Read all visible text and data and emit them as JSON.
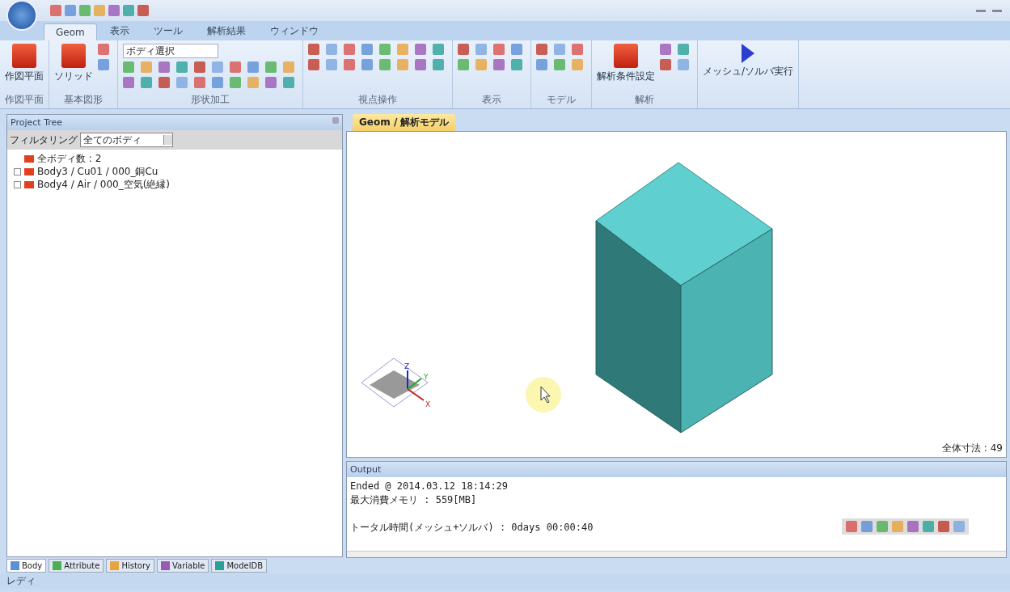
{
  "ribbon_tabs": [
    {
      "label": "Geom",
      "selected": true
    },
    {
      "label": "表示",
      "selected": false
    },
    {
      "label": "ツール",
      "selected": false
    },
    {
      "label": "解析結果",
      "selected": false
    },
    {
      "label": "ウィンドウ",
      "selected": false
    }
  ],
  "ribbon_groups": [
    {
      "label": "作図平面",
      "buttons": [
        "作図平面"
      ]
    },
    {
      "label": "基本図形",
      "buttons": [
        "ソリッド"
      ]
    },
    {
      "label": "形状加工",
      "combo": "ボディ選択"
    },
    {
      "label": "視点操作"
    },
    {
      "label": "表示"
    },
    {
      "label": "モデル"
    },
    {
      "label": "解析",
      "buttons": [
        "解析条件設定"
      ]
    },
    {
      "buttons": [
        "メッシュ/ソルバ実行"
      ]
    }
  ],
  "project_tree": {
    "title": "Project Tree",
    "filter_label": "フィルタリング",
    "filter_value": "全てのボディ",
    "items": [
      {
        "label": "全ボディ数 : 2",
        "expandable": false
      },
      {
        "label": "Body3 / Cu01 / 000_銅Cu",
        "expandable": true
      },
      {
        "label": "Body4 / Air / 000_空気(絶縁)",
        "expandable": true
      }
    ]
  },
  "bottom_tabs": [
    {
      "label": "Body",
      "selected": true
    },
    {
      "label": "Attribute",
      "selected": false
    },
    {
      "label": "History",
      "selected": false
    },
    {
      "label": "Variable",
      "selected": false
    },
    {
      "label": "ModelDB",
      "selected": false
    }
  ],
  "document_tab": {
    "label": "Geom / 解析モデル"
  },
  "viewport": {
    "axes": [
      "X",
      "Y",
      "Z"
    ],
    "scale_label": "全体寸法 : 49"
  },
  "output": {
    "title": "Output",
    "paragraphs": [
      [
        "Ended @ 2014.03.12 18:14:29",
        "最大消費メモリ : 559[MB]"
      ],
      [
        "トータル時間(メッシュ+ソルバ) : 0days 00:00:40"
      ]
    ]
  },
  "status_bar": {
    "text": "レディ"
  }
}
